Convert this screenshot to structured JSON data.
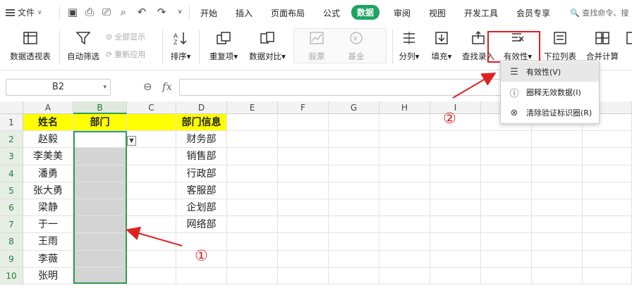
{
  "menubar": {
    "file_label": "文件",
    "tabs": [
      {
        "label": "开始",
        "active": false
      },
      {
        "label": "插入",
        "active": false
      },
      {
        "label": "页面布局",
        "active": false
      },
      {
        "label": "公式",
        "active": false
      },
      {
        "label": "数据",
        "active": true
      },
      {
        "label": "审阅",
        "active": false
      },
      {
        "label": "视图",
        "active": false
      },
      {
        "label": "开发工具",
        "active": false
      },
      {
        "label": "会员专享",
        "active": false
      }
    ],
    "search_placeholder": "查找命令、搜"
  },
  "ribbon": {
    "pivot": "数据透视表",
    "autofilter": "自动筛选",
    "show_all": "全部显示",
    "reapply": "重新应用",
    "sort": "排序",
    "duplicates": "重复项",
    "compare": "数据对比",
    "stocks": "股票",
    "funds": "基金",
    "split": "分列",
    "fill": "填充",
    "find_entry": "查找录入",
    "validity": "有效性",
    "dropdown_list": "下拉列表",
    "consolidate": "合并计算"
  },
  "formula_bar": {
    "name_box": "B2",
    "formula": ""
  },
  "columns": [
    "A",
    "B",
    "C",
    "D",
    "E",
    "F",
    "G",
    "H",
    "I"
  ],
  "rows": [
    "1",
    "2",
    "3",
    "4",
    "5",
    "6",
    "7",
    "8",
    "9",
    "10"
  ],
  "sheet": {
    "header": {
      "name": "姓名",
      "dept": "部门",
      "dept_info": "部门信息"
    },
    "names": [
      "赵毅",
      "李美美",
      "潘勇",
      "张大勇",
      "梁静",
      "于一",
      "王雨",
      "李薇",
      "张明"
    ],
    "departments": [
      "财务部",
      "销售部",
      "行政部",
      "客服部",
      "企划部",
      "网络部"
    ]
  },
  "validity_menu": {
    "items": [
      "有效性(V)",
      "圈释无效数据(I)",
      "清除验证标识圈(R)"
    ]
  },
  "callouts": [
    "①",
    "②"
  ],
  "colors": {
    "accent": "#1fa463",
    "highlight": "#e02020",
    "header_fill": "#ffff00",
    "selection": "#2e9e55"
  }
}
